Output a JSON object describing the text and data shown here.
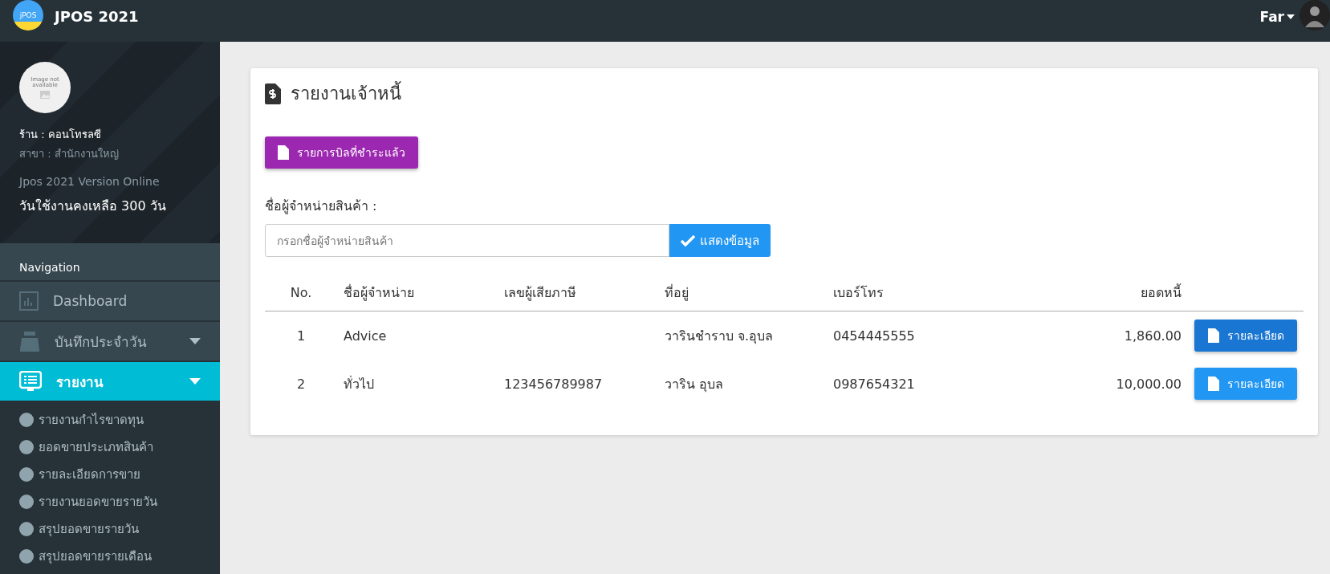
{
  "topbar": {
    "logo_text": "jPOS",
    "app_name": "JPOS 2021",
    "user": "Far"
  },
  "sidebar": {
    "profile_placeholder": "Image not available",
    "shop": "ร้าน : คอนโทรลซี",
    "branch": "สาขา : สำนักงานใหญ่",
    "version": "Jpos 2021 Version Online",
    "days_left": "วันใช้งานคงเหลือ 300 วัน",
    "nav_heading": "Navigation",
    "items": [
      {
        "label": "Dashboard",
        "kind": "chart",
        "selected": false,
        "expandable": false
      },
      {
        "label": "บันทึกประจำวัน",
        "kind": "register",
        "selected": false,
        "expandable": true
      },
      {
        "label": "รายงาน",
        "kind": "report",
        "selected": true,
        "expandable": true,
        "children": [
          {
            "label": "รายงานกำไรขาดทุน"
          },
          {
            "label": "ยอดขายประเภทสินค้า"
          },
          {
            "label": "รายละเอียดการขาย"
          },
          {
            "label": "รายงานยอดขายรายวัน"
          },
          {
            "label": "สรุปยอดขายรายวัน"
          },
          {
            "label": "สรุปยอดขายรายเดือน"
          }
        ]
      }
    ]
  },
  "card": {
    "title": "รายงานเจ้าหนี้",
    "paid_bills_button": "รายการบิลที่ชำระแล้ว",
    "supplier_label": "ชื่อผู้จำหน่ายสินค้า :",
    "supplier_placeholder": "กรอกชื่อผู้จำหน่ายสินค้า",
    "show_button": "แสดงข้อมูล",
    "table": {
      "columns": [
        "No.",
        "ชื่อผู้จำหน่าย",
        "เลขผู้เสียภาษี",
        "ที่อยู่",
        "เบอร์โทร",
        "ยอดหนี้"
      ],
      "rows": [
        {
          "cells": [
            "1",
            "Advice",
            "",
            "วารินชำราบ จ.อุบล",
            "0454445555",
            "1,860.00"
          ],
          "button": "รายละเอียด",
          "selected": true
        },
        {
          "cells": [
            "2",
            "ทั่วไป",
            "123456789987",
            "วาริน อุบล",
            "0987654321",
            "10,000.00"
          ],
          "button": "รายละเอียด",
          "selected": false
        }
      ]
    }
  }
}
